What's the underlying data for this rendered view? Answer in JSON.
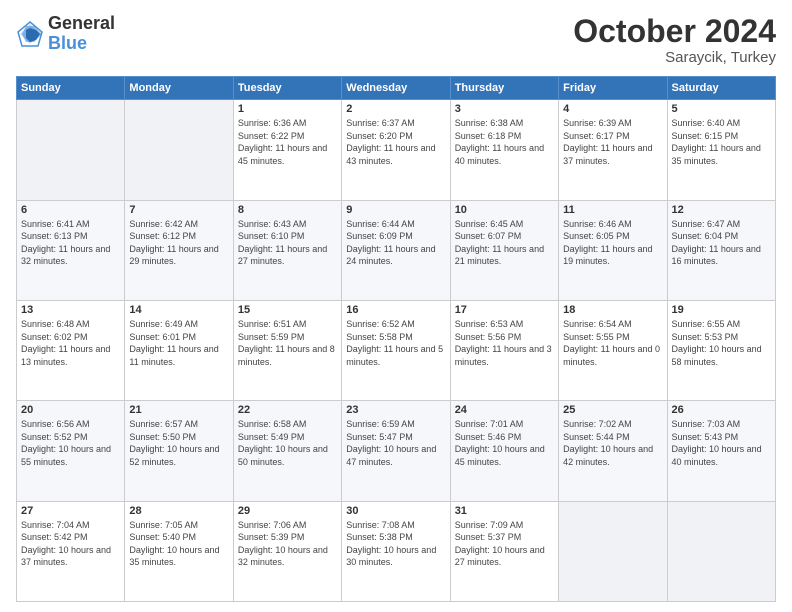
{
  "header": {
    "logo_line1": "General",
    "logo_line2": "Blue",
    "month": "October 2024",
    "location": "Saraycik, Turkey"
  },
  "weekdays": [
    "Sunday",
    "Monday",
    "Tuesday",
    "Wednesday",
    "Thursday",
    "Friday",
    "Saturday"
  ],
  "weeks": [
    [
      {
        "day": "",
        "content": ""
      },
      {
        "day": "",
        "content": ""
      },
      {
        "day": "1",
        "content": "Sunrise: 6:36 AM\nSunset: 6:22 PM\nDaylight: 11 hours and 45 minutes."
      },
      {
        "day": "2",
        "content": "Sunrise: 6:37 AM\nSunset: 6:20 PM\nDaylight: 11 hours and 43 minutes."
      },
      {
        "day": "3",
        "content": "Sunrise: 6:38 AM\nSunset: 6:18 PM\nDaylight: 11 hours and 40 minutes."
      },
      {
        "day": "4",
        "content": "Sunrise: 6:39 AM\nSunset: 6:17 PM\nDaylight: 11 hours and 37 minutes."
      },
      {
        "day": "5",
        "content": "Sunrise: 6:40 AM\nSunset: 6:15 PM\nDaylight: 11 hours and 35 minutes."
      }
    ],
    [
      {
        "day": "6",
        "content": "Sunrise: 6:41 AM\nSunset: 6:13 PM\nDaylight: 11 hours and 32 minutes."
      },
      {
        "day": "7",
        "content": "Sunrise: 6:42 AM\nSunset: 6:12 PM\nDaylight: 11 hours and 29 minutes."
      },
      {
        "day": "8",
        "content": "Sunrise: 6:43 AM\nSunset: 6:10 PM\nDaylight: 11 hours and 27 minutes."
      },
      {
        "day": "9",
        "content": "Sunrise: 6:44 AM\nSunset: 6:09 PM\nDaylight: 11 hours and 24 minutes."
      },
      {
        "day": "10",
        "content": "Sunrise: 6:45 AM\nSunset: 6:07 PM\nDaylight: 11 hours and 21 minutes."
      },
      {
        "day": "11",
        "content": "Sunrise: 6:46 AM\nSunset: 6:05 PM\nDaylight: 11 hours and 19 minutes."
      },
      {
        "day": "12",
        "content": "Sunrise: 6:47 AM\nSunset: 6:04 PM\nDaylight: 11 hours and 16 minutes."
      }
    ],
    [
      {
        "day": "13",
        "content": "Sunrise: 6:48 AM\nSunset: 6:02 PM\nDaylight: 11 hours and 13 minutes."
      },
      {
        "day": "14",
        "content": "Sunrise: 6:49 AM\nSunset: 6:01 PM\nDaylight: 11 hours and 11 minutes."
      },
      {
        "day": "15",
        "content": "Sunrise: 6:51 AM\nSunset: 5:59 PM\nDaylight: 11 hours and 8 minutes."
      },
      {
        "day": "16",
        "content": "Sunrise: 6:52 AM\nSunset: 5:58 PM\nDaylight: 11 hours and 5 minutes."
      },
      {
        "day": "17",
        "content": "Sunrise: 6:53 AM\nSunset: 5:56 PM\nDaylight: 11 hours and 3 minutes."
      },
      {
        "day": "18",
        "content": "Sunrise: 6:54 AM\nSunset: 5:55 PM\nDaylight: 11 hours and 0 minutes."
      },
      {
        "day": "19",
        "content": "Sunrise: 6:55 AM\nSunset: 5:53 PM\nDaylight: 10 hours and 58 minutes."
      }
    ],
    [
      {
        "day": "20",
        "content": "Sunrise: 6:56 AM\nSunset: 5:52 PM\nDaylight: 10 hours and 55 minutes."
      },
      {
        "day": "21",
        "content": "Sunrise: 6:57 AM\nSunset: 5:50 PM\nDaylight: 10 hours and 52 minutes."
      },
      {
        "day": "22",
        "content": "Sunrise: 6:58 AM\nSunset: 5:49 PM\nDaylight: 10 hours and 50 minutes."
      },
      {
        "day": "23",
        "content": "Sunrise: 6:59 AM\nSunset: 5:47 PM\nDaylight: 10 hours and 47 minutes."
      },
      {
        "day": "24",
        "content": "Sunrise: 7:01 AM\nSunset: 5:46 PM\nDaylight: 10 hours and 45 minutes."
      },
      {
        "day": "25",
        "content": "Sunrise: 7:02 AM\nSunset: 5:44 PM\nDaylight: 10 hours and 42 minutes."
      },
      {
        "day": "26",
        "content": "Sunrise: 7:03 AM\nSunset: 5:43 PM\nDaylight: 10 hours and 40 minutes."
      }
    ],
    [
      {
        "day": "27",
        "content": "Sunrise: 7:04 AM\nSunset: 5:42 PM\nDaylight: 10 hours and 37 minutes."
      },
      {
        "day": "28",
        "content": "Sunrise: 7:05 AM\nSunset: 5:40 PM\nDaylight: 10 hours and 35 minutes."
      },
      {
        "day": "29",
        "content": "Sunrise: 7:06 AM\nSunset: 5:39 PM\nDaylight: 10 hours and 32 minutes."
      },
      {
        "day": "30",
        "content": "Sunrise: 7:08 AM\nSunset: 5:38 PM\nDaylight: 10 hours and 30 minutes."
      },
      {
        "day": "31",
        "content": "Sunrise: 7:09 AM\nSunset: 5:37 PM\nDaylight: 10 hours and 27 minutes."
      },
      {
        "day": "",
        "content": ""
      },
      {
        "day": "",
        "content": ""
      }
    ]
  ]
}
